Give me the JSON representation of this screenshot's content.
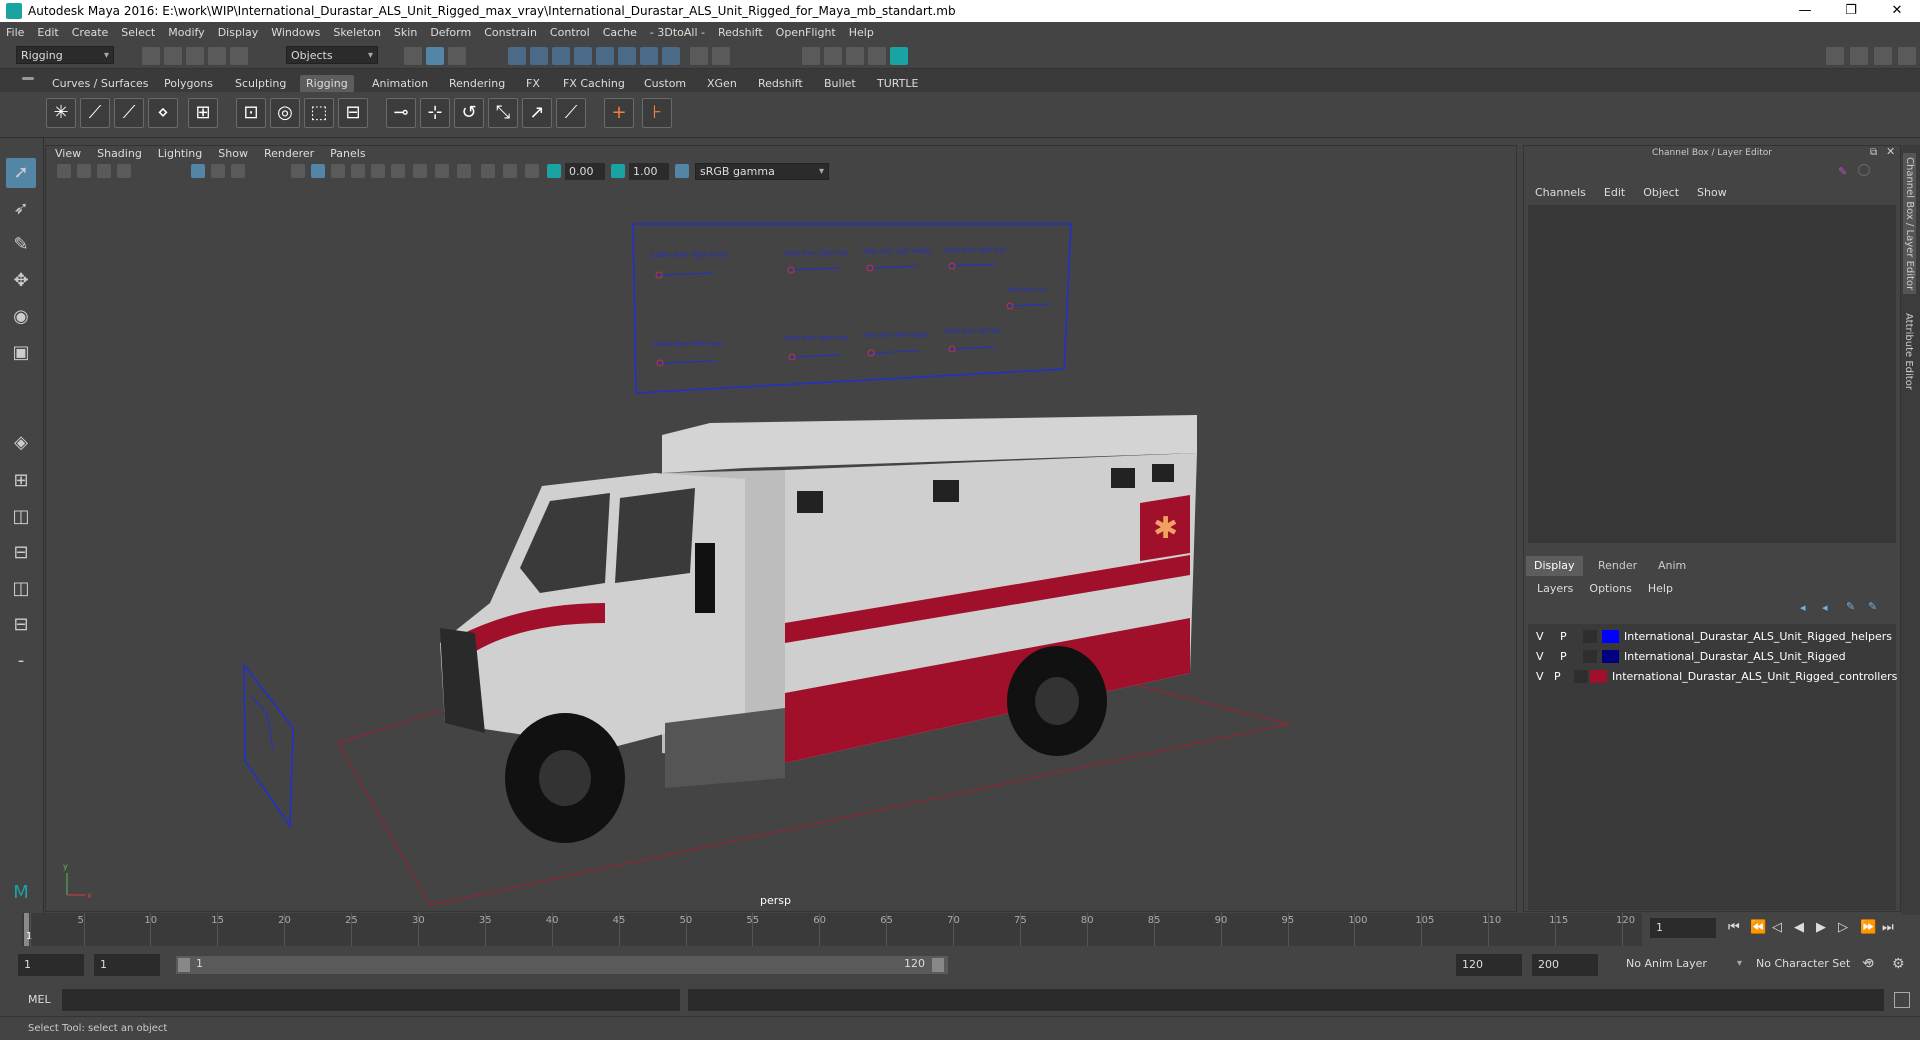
{
  "title": "Autodesk Maya 2016: E:\\work\\WIP\\International_Durastar_ALS_Unit_Rigged_max_vray\\International_Durastar_ALS_Unit_Rigged_for_Maya_mb_standart.mb",
  "window_controls": {
    "minimize": "—",
    "maximize": "❐",
    "close": "✕"
  },
  "menu": [
    "File",
    "Edit",
    "Create",
    "Select",
    "Modify",
    "Display",
    "Windows",
    "Skeleton",
    "Skin",
    "Deform",
    "Constrain",
    "Control",
    "Cache",
    "- 3DtoAll -",
    "Redshift",
    "OpenFlight",
    "Help"
  ],
  "status_line": {
    "menuset": "Rigging",
    "selection_mode": "Objects"
  },
  "shelf_tabs": [
    "Curves / Surfaces",
    "Polygons",
    "Sculpting",
    "Rigging",
    "Animation",
    "Rendering",
    "FX",
    "FX Caching",
    "Custom",
    "XGen",
    "Redshift",
    "Bullet",
    "TURTLE"
  ],
  "active_shelf_tab": "Rigging",
  "viewport": {
    "menu": [
      "View",
      "Shading",
      "Lighting",
      "Show",
      "Renderer",
      "Panels"
    ],
    "field_a": "0.00",
    "field_b": "1.00",
    "color_space": "sRGB gamma",
    "camera_label": "persp",
    "axis_y": "y",
    "axis_x": "x",
    "control_labels": {
      "cab_front_right": "Cabin door right front",
      "body_front_right": "Body door right front",
      "body_middle_right": "Body door right middle",
      "body_rear_right": "Body door right rear",
      "body_rear": "Body_door_rear",
      "cab_front_left": "Cabin door left front",
      "body_front_left": "Body door right front",
      "body_middle_left": "Body door left middle",
      "body_rear_left": "Body door left rear"
    }
  },
  "channel_box": {
    "title": "Channel Box / Layer Editor",
    "menu": [
      "Channels",
      "Edit",
      "Object",
      "Show"
    ],
    "tabs": [
      "Display",
      "Render",
      "Anim"
    ],
    "active_tab": "Display",
    "layer_menu": [
      "Layers",
      "Options",
      "Help"
    ],
    "layers": [
      {
        "v": "V",
        "p": "P",
        "name": "International_Durastar_ALS_Unit_Rigged_helpers",
        "color": "#0000ff"
      },
      {
        "v": "V",
        "p": "P",
        "name": "International_Durastar_ALS_Unit_Rigged",
        "color": "#000080"
      },
      {
        "v": "V",
        "p": "P",
        "name": "International_Durastar_ALS_Unit_Rigged_controllers",
        "color": "#a0102a"
      }
    ]
  },
  "side_tabs": [
    "Channel Box / Layer Editor",
    "Attribute Editor"
  ],
  "time_slider": {
    "ticks": [
      "1",
      "5",
      "10",
      "15",
      "20",
      "25",
      "30",
      "35",
      "40",
      "45",
      "50",
      "55",
      "60",
      "65",
      "70",
      "75",
      "80",
      "85",
      "90",
      "95",
      "100",
      "105",
      "110",
      "115",
      "120"
    ],
    "current_frame": "1"
  },
  "range_slider": {
    "start": "1",
    "anim_start": "1",
    "range_start": "1",
    "range_end": "120",
    "end": "120",
    "anim_end": "200",
    "anim_layer": "No Anim Layer",
    "character_set": "No Character Set"
  },
  "command_line": {
    "label": "MEL"
  },
  "help_line": "Select Tool: select an object"
}
